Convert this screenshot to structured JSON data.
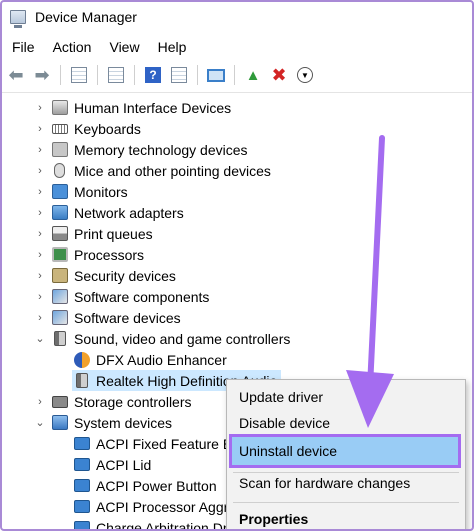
{
  "window": {
    "title": "Device Manager"
  },
  "menu": [
    "File",
    "Action",
    "View",
    "Help"
  ],
  "toolbar": {
    "icons": [
      "back-arrow-icon",
      "forward-arrow-icon",
      "properties-icon",
      "sheet-icon",
      "help-icon",
      "update-driver-icon",
      "monitor-icon",
      "enable-icon",
      "uninstall-x-icon",
      "download-icon"
    ]
  },
  "tree": {
    "categories": [
      {
        "label": "Human Interface Devices",
        "icon": "hid-icon"
      },
      {
        "label": "Keyboards",
        "icon": "keyboard-icon"
      },
      {
        "label": "Memory technology devices",
        "icon": "memory-icon"
      },
      {
        "label": "Mice and other pointing devices",
        "icon": "mouse-icon"
      },
      {
        "label": "Monitors",
        "icon": "monitor-icon"
      },
      {
        "label": "Network adapters",
        "icon": "network-icon"
      },
      {
        "label": "Print queues",
        "icon": "printer-icon"
      },
      {
        "label": "Processors",
        "icon": "processor-icon"
      },
      {
        "label": "Security devices",
        "icon": "security-icon"
      },
      {
        "label": "Software components",
        "icon": "software-icon"
      },
      {
        "label": "Software devices",
        "icon": "software-icon"
      },
      {
        "label": "Sound, video and game controllers",
        "icon": "sound-icon"
      }
    ],
    "sound_children": [
      {
        "label": "DFX Audio Enhancer",
        "icon": "dfx-icon"
      },
      {
        "label": "Realtek High Definition Audio",
        "icon": "speaker-icon"
      }
    ],
    "storage": {
      "label": "Storage controllers",
      "icon": "storage-icon"
    },
    "system": {
      "label": "System devices",
      "icon": "system-icon"
    },
    "system_children": [
      {
        "label": "ACPI Fixed Feature Button",
        "icon": "acpi-icon"
      },
      {
        "label": "ACPI Lid",
        "icon": "acpi-icon"
      },
      {
        "label": "ACPI Power Button",
        "icon": "acpi-icon"
      },
      {
        "label": "ACPI Processor Aggregator",
        "icon": "acpi-icon"
      },
      {
        "label": "Charge Arbitration Driver",
        "icon": "acpi-icon"
      }
    ]
  },
  "context_menu": {
    "update": "Update driver",
    "disable": "Disable device",
    "uninstall": "Uninstall device",
    "scan": "Scan for hardware changes",
    "properties": "Properties"
  },
  "colors": {
    "annotation": "#a46cf0",
    "highlight": "#99ccf5",
    "selection": "#cce8ff"
  }
}
